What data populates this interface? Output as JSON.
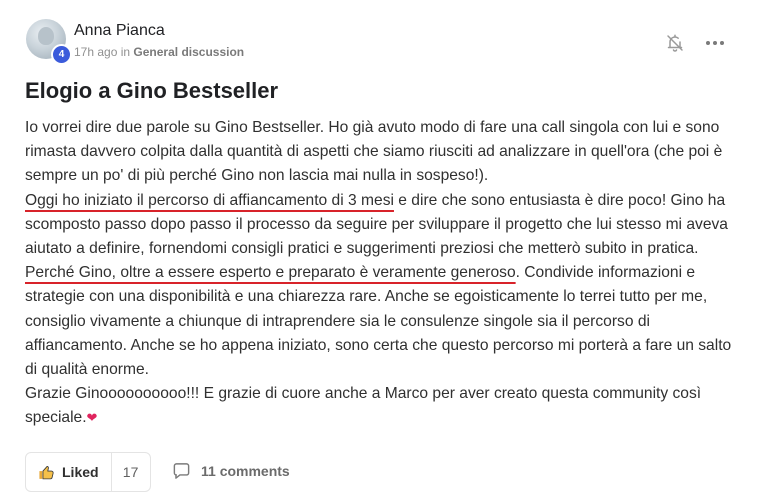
{
  "author": {
    "name": "Anna Pianca",
    "level": "4",
    "time_ago": "17h ago",
    "in_word": "in",
    "category": "General discussion"
  },
  "icons": {
    "notify": "bell-off-icon",
    "more": "more-horizontal-icon",
    "like": "thumbs-up-icon",
    "comment": "comment-bubble-icon",
    "heart": "heart-icon"
  },
  "colors": {
    "badge": "#3b5bdb",
    "underline": "#d8232a",
    "heart": "#e0245e"
  },
  "post": {
    "title": "Elogio a Gino Bestseller",
    "body": {
      "p1_intro": "Io vorrei dire due parole su Gino Bestseller. Ho già avuto modo di fare una call singola con lui e sono rimasta davvero colpita dalla quantità di aspetti che siamo riusciti ad analizzare in quell'ora (che poi è sempre un po' di più perché Gino non lascia mai nulla in sospeso!).",
      "p2_underlined": "Oggi ho iniziato il percorso di affiancamento di 3 mesi",
      "p2_rest": " e dire che sono entusiasta è dire poco! Gino ha scomposto passo dopo passo il processo da seguire per sviluppare il progetto che lui stesso mi aveva aiutato a definire, fornendomi consigli pratici e suggerimenti preziosi che metterò subito in pratica. ",
      "p2_underlined_2": "Perché Gino, oltre a essere esperto e preparato è veramente generoso",
      "p2_end": ". Condivide informazioni e strategie con una disponibilità e una chiarezza rare. Anche se egoisticamente lo terrei tutto per me, consiglio vivamente a chiunque di intraprendere sia le consulenze singole sia il percorso di affiancamento. Anche se ho appena iniziato, sono certa che questo percorso mi porterà a fare un salto di qualità enorme.",
      "p3": "Grazie Ginoooooooooo!!! E grazie di cuore anche a Marco per aver creato questa community così speciale.",
      "heart": "❤"
    }
  },
  "footer": {
    "like_label": "Liked",
    "like_count": "17",
    "comments_label": "11 comments"
  }
}
